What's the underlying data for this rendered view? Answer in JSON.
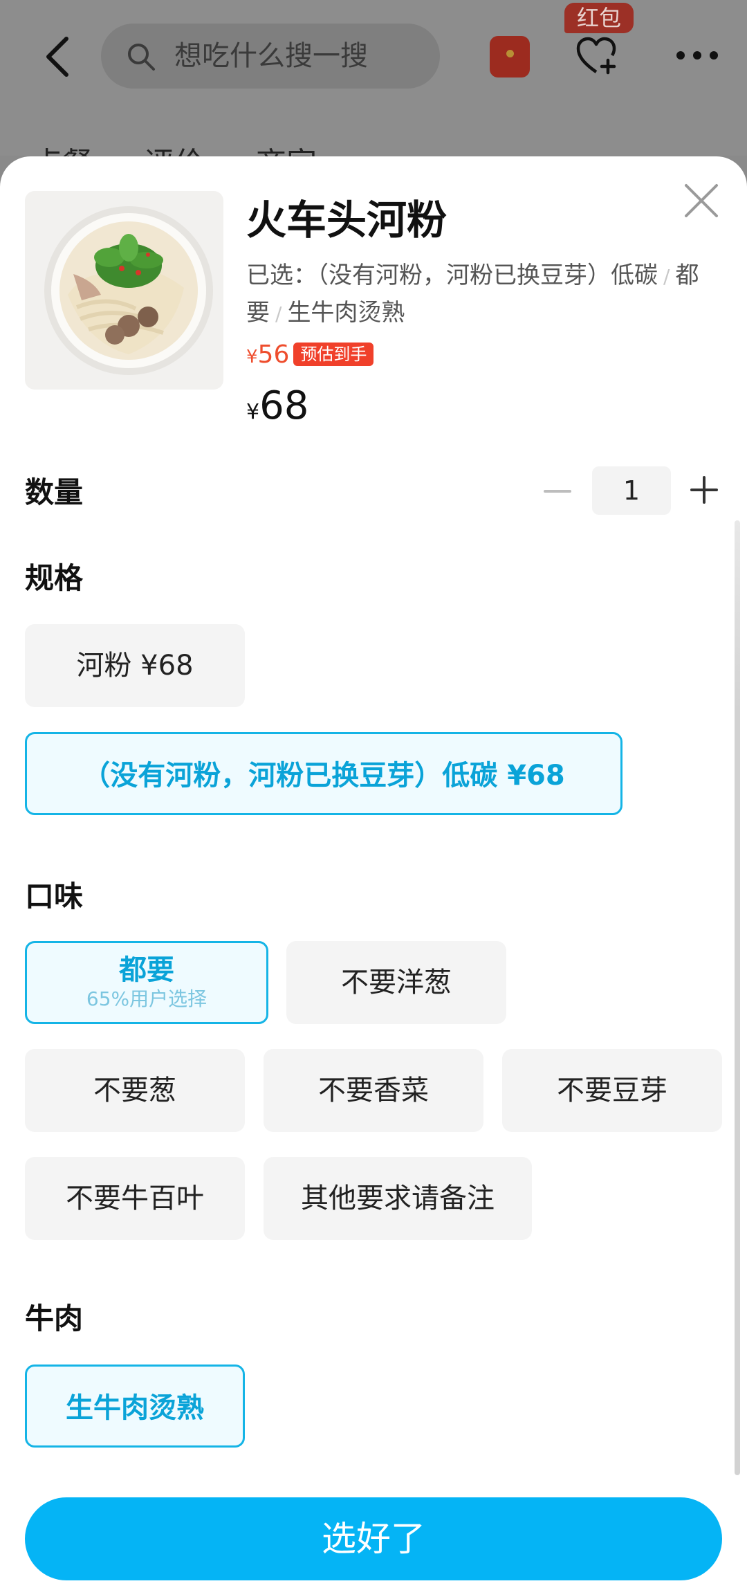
{
  "header": {
    "search_placeholder": "想吃什么搜一搜",
    "red_packet_badge": "红包",
    "tabs": [
      "点餐",
      "评价",
      "商家"
    ]
  },
  "dish": {
    "name": "火车头河粉",
    "selected_prefix": "已选：",
    "selected_items": [
      "（没有河粉，河粉已换豆芽）低碳",
      "都要",
      "生牛肉烫熟"
    ],
    "estimated_currency": "¥",
    "estimated_price": "56",
    "estimated_tag": "预估到手",
    "price_currency": "¥",
    "price": "68"
  },
  "quantity": {
    "label": "数量",
    "value": "1"
  },
  "spec": {
    "label": "规格",
    "options": [
      {
        "text": "河粉 ¥68",
        "selected": false
      },
      {
        "text": "（没有河粉，河粉已换豆芽）低碳 ¥68",
        "selected": true
      }
    ]
  },
  "flavor": {
    "label": "口味",
    "options": [
      {
        "text": "都要",
        "sub": "65%用户选择",
        "selected": true
      },
      {
        "text": "不要洋葱",
        "selected": false
      },
      {
        "text": "不要葱",
        "selected": false
      },
      {
        "text": "不要香菜",
        "selected": false
      },
      {
        "text": "不要豆芽",
        "selected": false
      },
      {
        "text": "不要牛百叶",
        "selected": false
      },
      {
        "text": "其他要求请备注",
        "selected": false
      }
    ]
  },
  "beef": {
    "label": "牛肉",
    "options": [
      {
        "text": "生牛肉烫熟",
        "selected": true
      }
    ]
  },
  "confirm_button": "选好了",
  "colors": {
    "accent": "#05b4f5",
    "selected_border": "#14b4e6",
    "price_red": "#ee4d2d"
  }
}
